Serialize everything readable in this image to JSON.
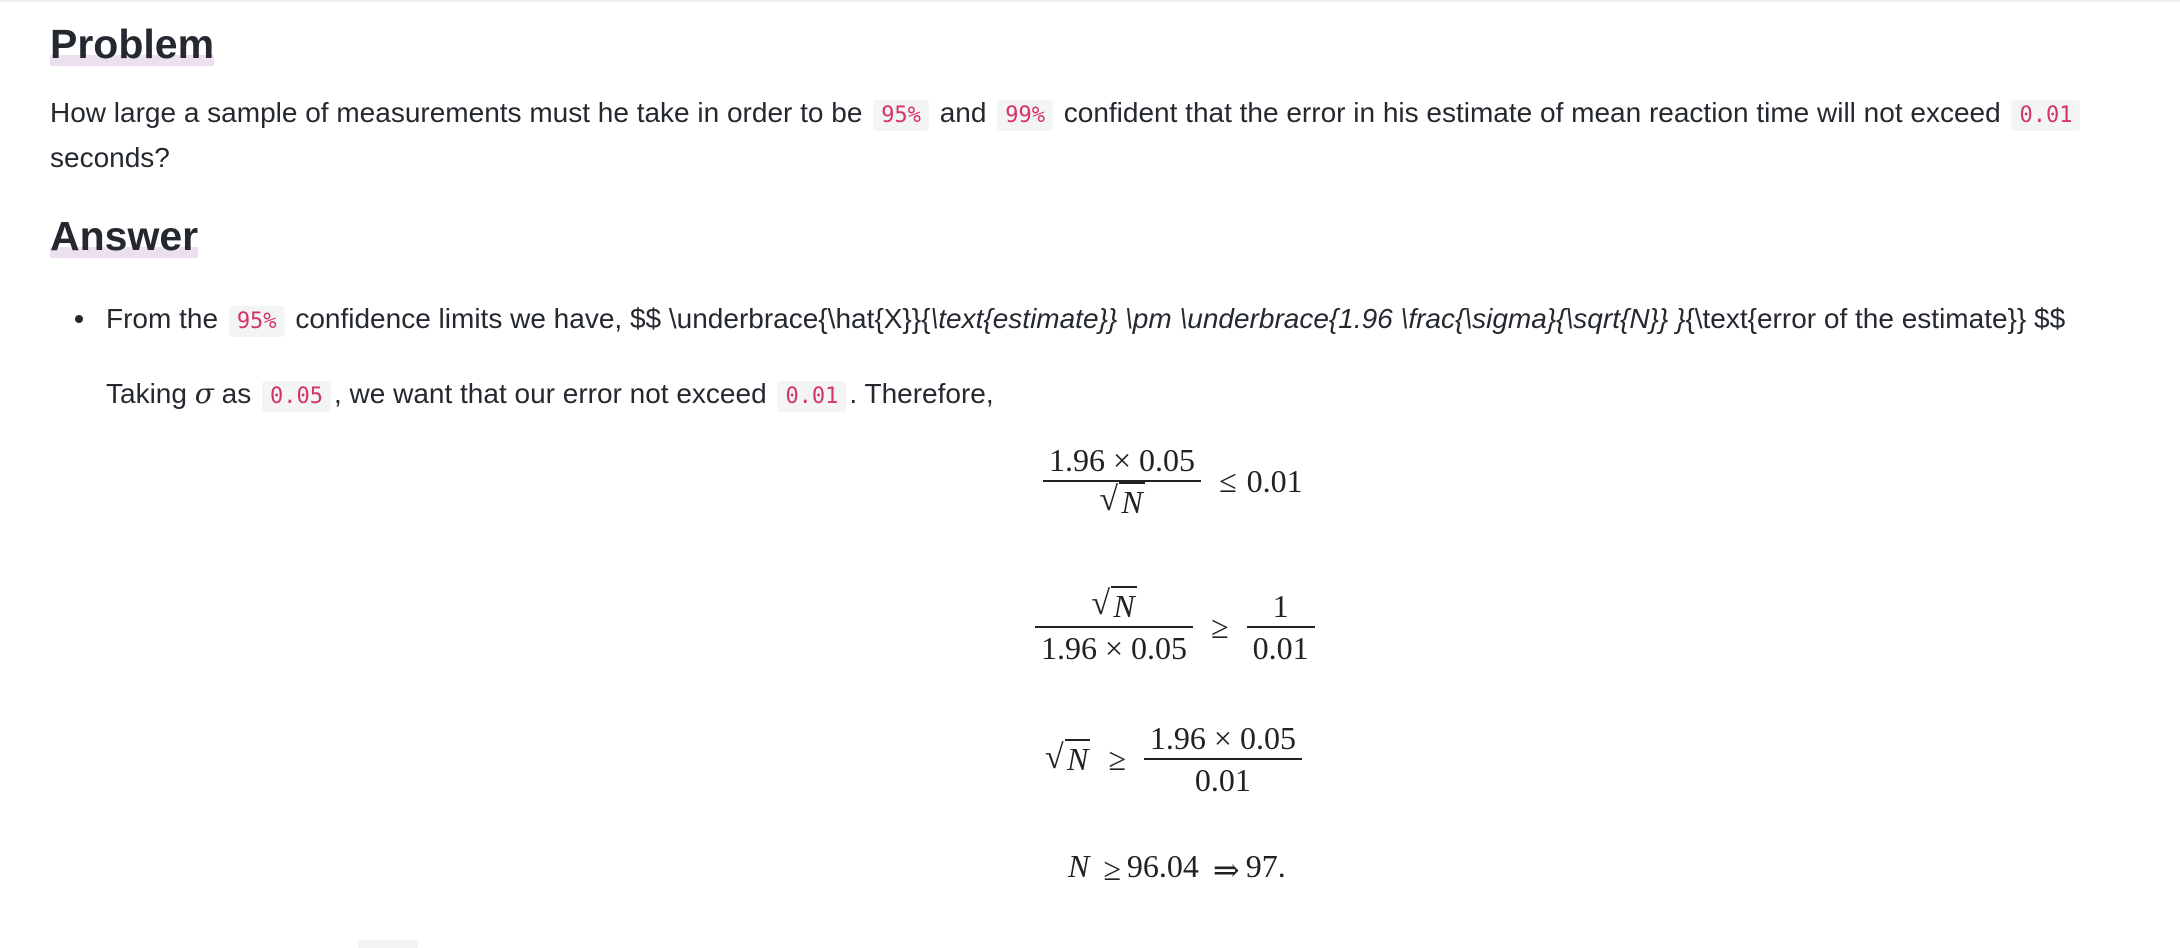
{
  "problem": {
    "heading": "Problem",
    "text_1": "How large a sample of measurements must he take in order to be",
    "code_1": "95%",
    "text_2": "and",
    "code_2": "99%",
    "text_3": "confident that the error in his estimate of mean reaction time will not exceed",
    "code_3": "0.01",
    "text_4": "seconds?"
  },
  "answer": {
    "heading": "Answer",
    "bullet_1": {
      "text_1": "From the",
      "code_1": "95%",
      "text_2": "confidence limits we have, $$ \\underbrace{\\hat{X}}{",
      "italic_1": "\\text{estimate}} \\pm \\underbrace{1.96 \\frac{\\sigma}{\\sqrt{N}} }",
      "text_3": "{\\text{error of the estimate}} $$"
    },
    "therefore": {
      "text_1": "Taking",
      "sigma": "σ",
      "text_2": "as",
      "code_1": "0.05",
      "text_3": ", we want that our error not exceed",
      "code_2": "0.01",
      "text_4": ". Therefore,"
    },
    "equations": {
      "eq1": {
        "num": "1.96 × 0.05",
        "den_var": "N",
        "op": "≤",
        "rhs": "0.01"
      },
      "eq2": {
        "num_var": "N",
        "den": "1.96 × 0.05",
        "op": "≥",
        "rhs_num": "1",
        "rhs_den": "0.01"
      },
      "eq3": {
        "lhs_var": "N",
        "op": "≥",
        "rhs_num": "1.96 × 0.05",
        "rhs_den": "0.01"
      },
      "eq4": {
        "lhs_var": "N",
        "op": "≥",
        "value": "96.04",
        "implies": "⇒",
        "result": "97."
      }
    }
  }
}
